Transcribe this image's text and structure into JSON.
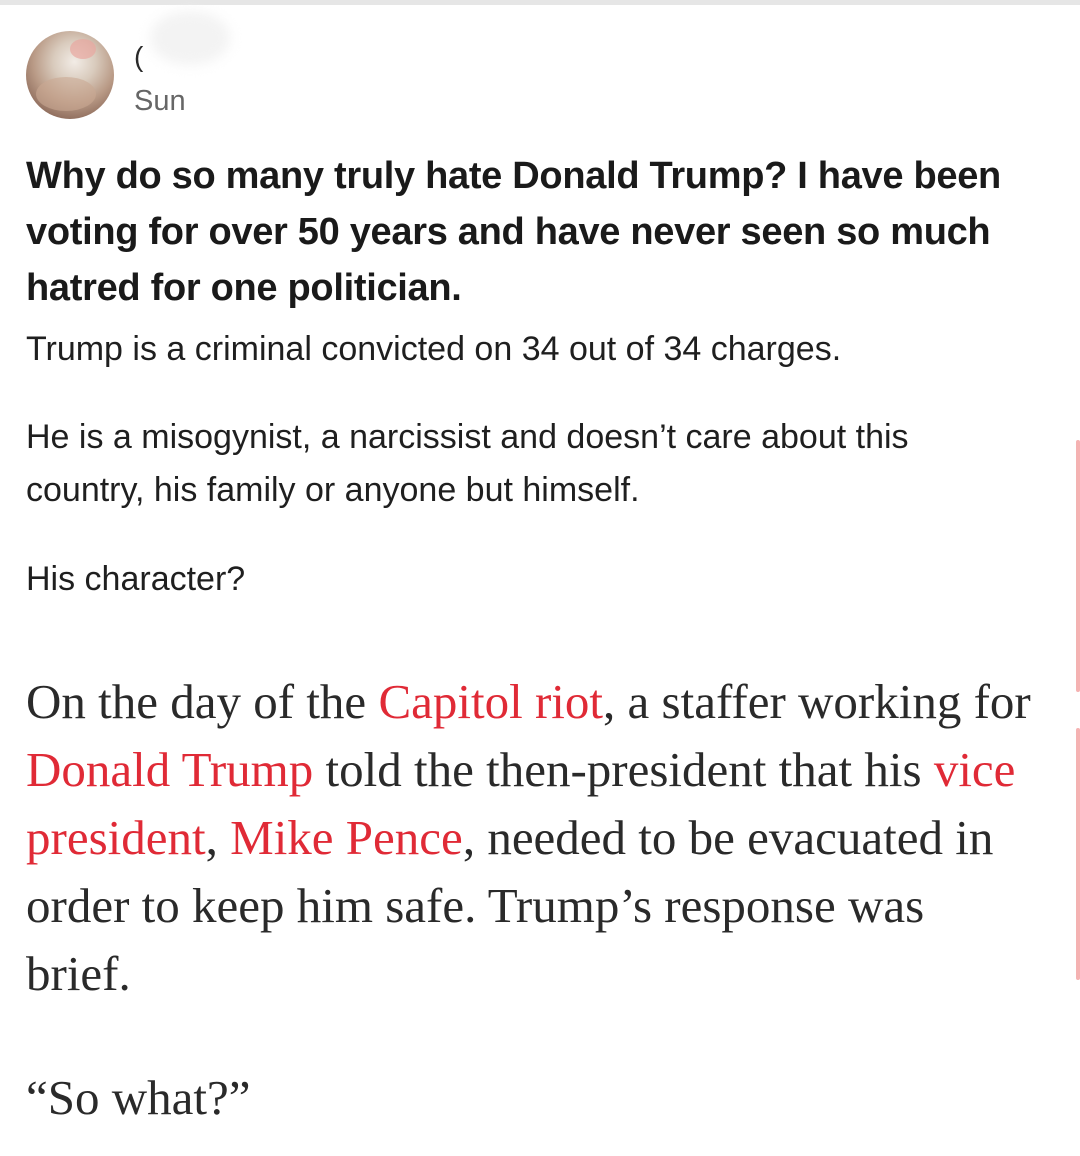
{
  "post": {
    "author_initial": "(",
    "time": "Sun",
    "question": "Why do so many truly hate Donald Trump? I have been voting for over 50 years and have never seen so much hatred for one politician.",
    "answer_paragraphs": [
      "Trump is a criminal convicted on 34 out of 34 charges.",
      "He is a misogynist, a narcissist and doesn’t care about this country, his family or anyone but himself.",
      "His character?"
    ]
  },
  "quote": {
    "segments": [
      {
        "text": "On the day of the ",
        "link": false
      },
      {
        "text": "Capitol riot",
        "link": true
      },
      {
        "text": ", a staffer working for ",
        "link": false
      },
      {
        "text": "Donald Trump",
        "link": true
      },
      {
        "text": " told the then-president that his ",
        "link": false
      },
      {
        "text": "vice president",
        "link": true
      },
      {
        "text": ", ",
        "link": false
      },
      {
        "text": "Mike Pence",
        "link": true
      },
      {
        "text": ", needed to be evacuated in order to keep him safe. Trump’s response was brief.",
        "link": false
      }
    ],
    "closing": "“So what?”"
  },
  "colors": {
    "link": "#e02a36",
    "text": "#1a1a1a",
    "muted": "#666666",
    "scroll_indicator": "#f5b2b2"
  },
  "icons": {
    "avatar": "profile-photo"
  }
}
